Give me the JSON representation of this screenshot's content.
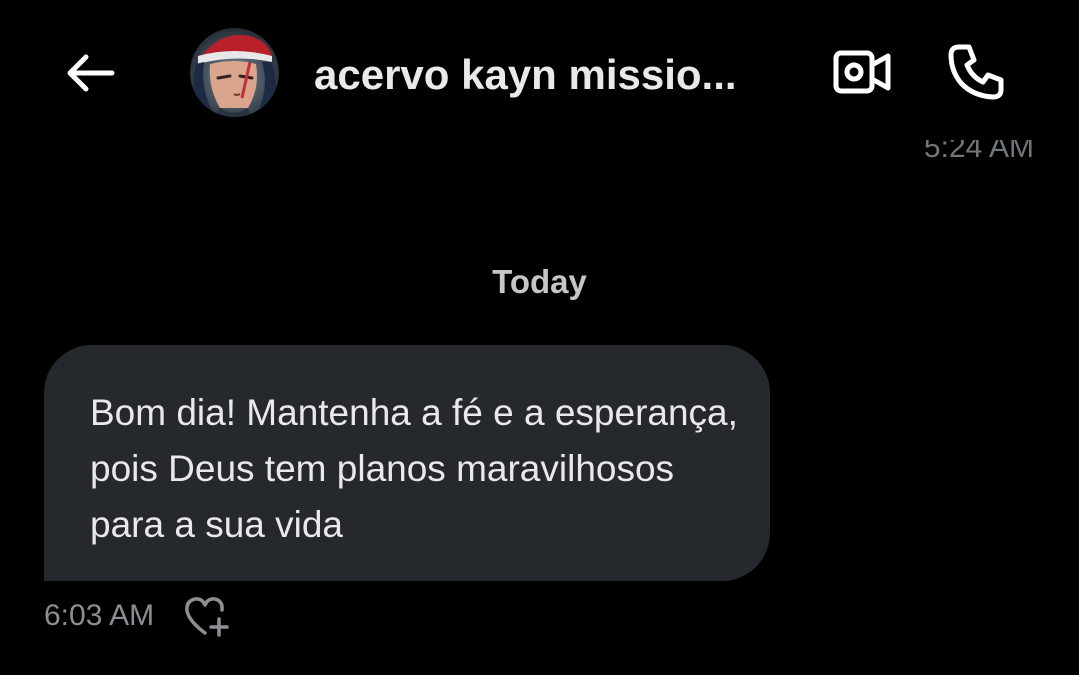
{
  "header": {
    "contact_name": "acervo kayn missio...",
    "back_icon": "arrow-left-icon",
    "video_icon": "video-camera-icon",
    "call_icon": "phone-icon"
  },
  "conversation": {
    "previous_timestamp": "5:24 AM",
    "day_divider": "Today",
    "message": {
      "text": "Bom dia! Mantenha a fé e a esperança, pois Deus tem planos maravilhosos para a sua vida",
      "timestamp": "6:03 AM",
      "reaction_icon": "heart-plus-icon"
    }
  },
  "colors": {
    "background": "#000000",
    "bubble": "#25292e",
    "text": "#e7e9ea",
    "muted": "#71767b"
  }
}
